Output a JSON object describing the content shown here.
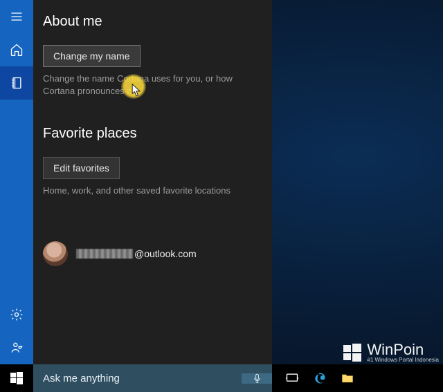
{
  "rail": {
    "items": [
      {
        "name": "menu"
      },
      {
        "name": "home"
      },
      {
        "name": "notebook"
      }
    ],
    "bottom": [
      {
        "name": "settings"
      },
      {
        "name": "feedback"
      }
    ]
  },
  "panel": {
    "about": {
      "heading": "About me",
      "button": "Change my name",
      "desc": "Change the name Cortana uses for you, or how Cortana pronounces it."
    },
    "places": {
      "heading": "Favorite places",
      "button": "Edit favorites",
      "desc": "Home, work, and other saved favorite locations"
    },
    "account": {
      "email_suffix": "@outlook.com"
    }
  },
  "taskbar": {
    "search_placeholder": "Ask me anything"
  },
  "watermark": {
    "brand": "WinPoin",
    "tagline": "#1 Windows Portal Indonesia"
  }
}
